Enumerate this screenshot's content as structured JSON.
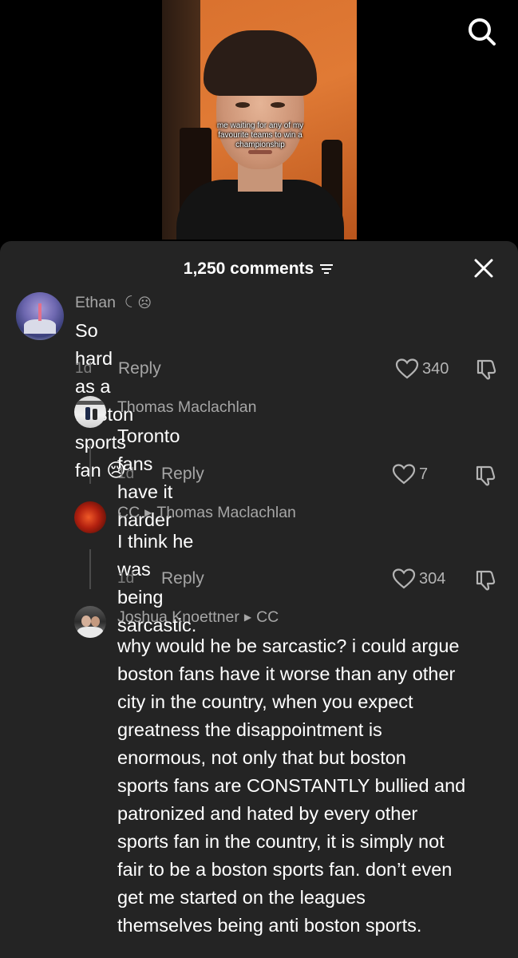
{
  "video": {
    "caption": "me waiting for any of my favourite teams to win a championship"
  },
  "icons": {
    "search": "search-icon",
    "close": "close-icon",
    "sort": "sort-icon",
    "like": "heart-icon",
    "dislike": "thumbs-down-icon"
  },
  "comments_header": {
    "count_label": "1,250 comments"
  },
  "comments": [
    {
      "username": "Ethan",
      "user_badge": "ꉔ ☹",
      "reply_to": "",
      "text": "So hard as a Boston sports fan 😢",
      "time": "1d",
      "reply_label": "Reply",
      "likes": "340"
    },
    {
      "username": "Thomas Maclachlan",
      "reply_to": "",
      "text": "Toronto fans have it harder",
      "time": "1d",
      "reply_label": "Reply",
      "likes": "7"
    },
    {
      "username": "CC",
      "reply_to": "Thomas Maclachlan",
      "text": "I think he was being sarcastic.",
      "time": "1d",
      "reply_label": "Reply",
      "likes": "304"
    },
    {
      "username": "Joshua Knoettner",
      "reply_to": "CC",
      "text_lines": [
        "why would he be sarcastic? i could argue",
        "boston fans have it worse than any other",
        "city in the country, when you expect",
        "greatness the disappointment is",
        "enormous, not only that but boston",
        "sports fans are CONSTANTLY bullied and",
        "patronized and hated by every other",
        "sports fan in the country, it is simply not",
        "fair to be a boston sports fan. don’t even",
        "get me started on the leagues",
        "themselves being anti boston sports."
      ]
    }
  ],
  "colors": {
    "panel_bg": "#242424",
    "secondary_text": "#a6a6a6",
    "primary_text": "#ffffff"
  }
}
